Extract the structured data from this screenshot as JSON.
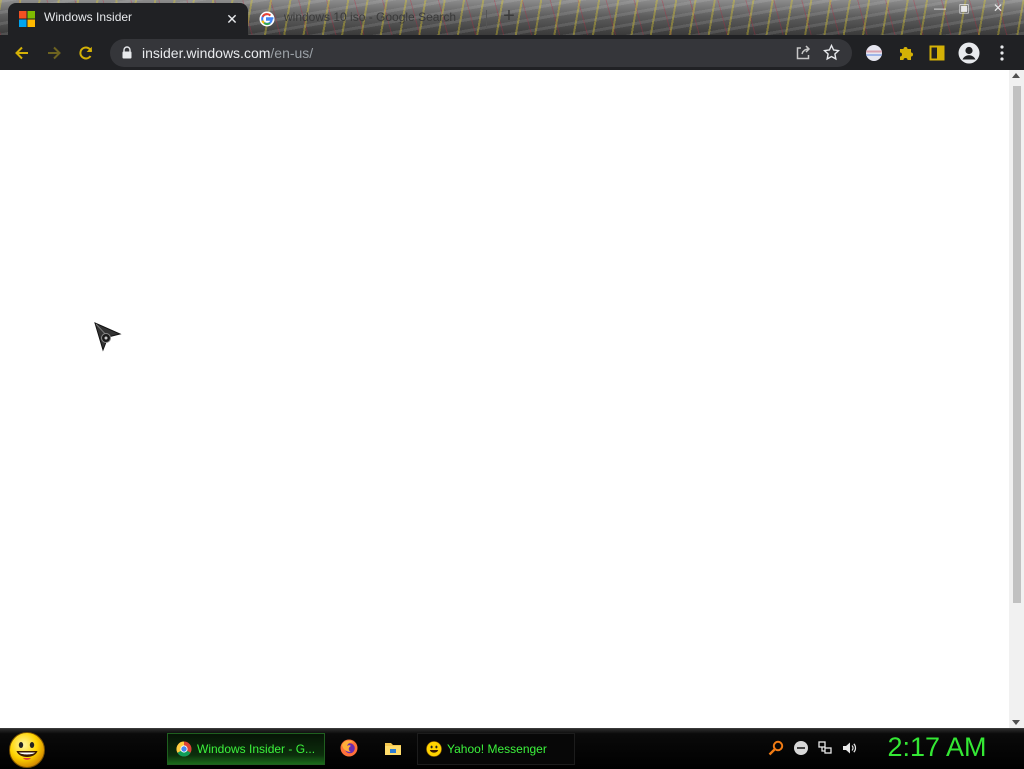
{
  "browser": {
    "tabs": [
      {
        "title": "Windows Insider",
        "favicon": "microsoft-logo-icon",
        "active": true
      },
      {
        "title": "windows 10 iso - Google Search",
        "favicon": "google-logo-icon",
        "active": false
      }
    ],
    "toolbar": {
      "url_host": "insider.windows.com",
      "url_path": "/en-us/"
    },
    "colors": {
      "frame_dark": "#202124",
      "omnibox": "#35363a",
      "toolbar_icon": "#e8eaed",
      "extension_gold": "#d4b106"
    }
  },
  "page": {
    "content": ""
  },
  "taskbar": {
    "tasks": [
      {
        "label": "Windows Insider - G...",
        "icon": "chrome-icon",
        "active": true
      },
      {
        "label": "Yahoo! Messenger",
        "icon": "yahoo-smiley-icon",
        "active": false
      }
    ],
    "quick_launch": [
      "firefox-icon",
      "file-explorer-icon"
    ],
    "tray_icons": [
      "search-icon",
      "minus-circle-icon",
      "network-icon",
      "volume-icon"
    ],
    "clock": "2:17 AM",
    "colors": {
      "accent_green": "#34e834"
    }
  }
}
